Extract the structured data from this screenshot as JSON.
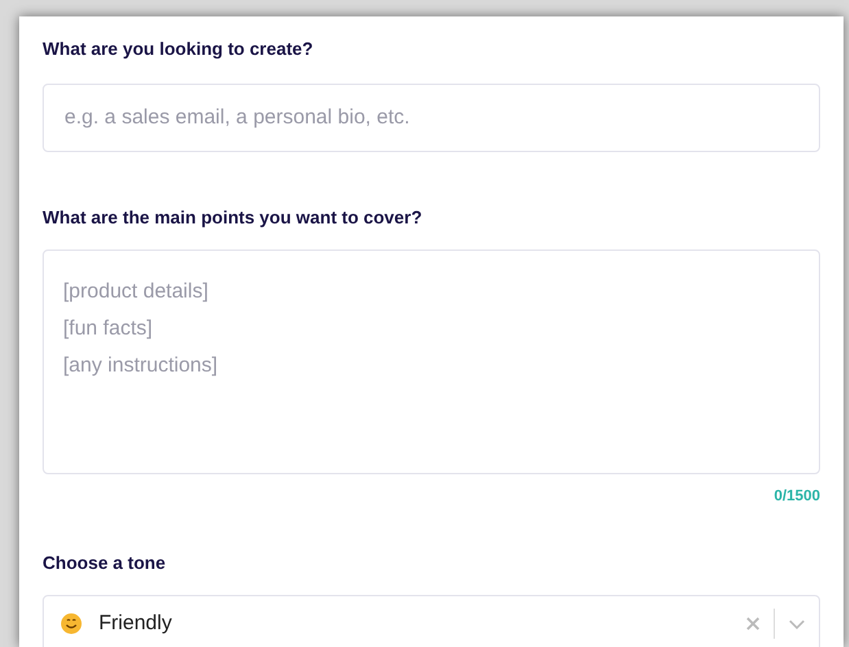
{
  "fields": [
    {
      "kind": "input",
      "label": "What are you looking to create?",
      "placeholder": "e.g. a sales email, a personal bio, etc."
    },
    {
      "kind": "textarea",
      "label": "What are the main points you want to cover?",
      "placeholder": "[product details]\n[fun facts]\n[any instructions]",
      "counter": "0/1500"
    },
    {
      "kind": "select",
      "label": "Choose a tone",
      "value": "Friendly"
    }
  ]
}
